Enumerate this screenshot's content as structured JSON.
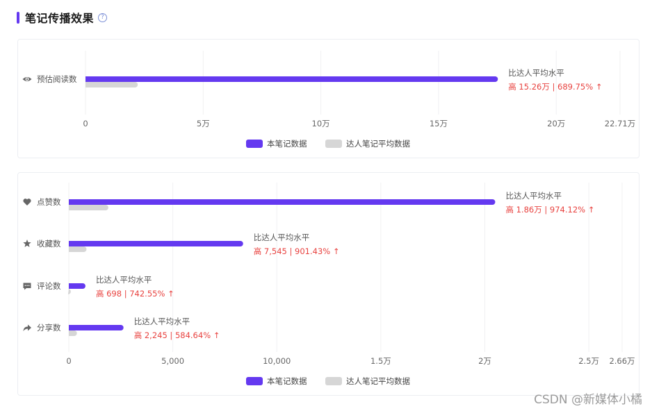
{
  "header": {
    "title": "笔记传播效果",
    "help_icon": "question-circle-icon",
    "accent_color": "#6439f0"
  },
  "legend": {
    "this_note": "本笔记数据",
    "influencer_avg": "达人笔记平均数据"
  },
  "colors": {
    "this_note": "#6439f0",
    "influencer_avg": "#d6d6d6",
    "highlight": "#e8423f"
  },
  "watermark": "CSDN @新媒体小橘",
  "chart_data": [
    {
      "type": "bar",
      "orientation": "horizontal",
      "categories": [
        "预估阅读数"
      ],
      "icons": [
        "eye-icon"
      ],
      "series": [
        {
          "name": "本笔记数据",
          "values": [
            175200
          ]
        },
        {
          "name": "达人笔记平均数据",
          "values": [
            22200
          ]
        }
      ],
      "xlim": [
        0,
        227100
      ],
      "xticks": [
        0,
        50000,
        100000,
        150000,
        200000,
        227100
      ],
      "xtick_labels": [
        "0",
        "5万",
        "10万",
        "15万",
        "20万",
        "22.71万"
      ],
      "annotations": [
        {
          "title": "比达人平均水平",
          "value": "高 15.26万 | 689.75% ↑"
        }
      ],
      "legend_position": "bottom"
    },
    {
      "type": "bar",
      "orientation": "horizontal",
      "categories": [
        "点赞数",
        "收藏数",
        "评论数",
        "分享数"
      ],
      "icons": [
        "heart-icon",
        "star-icon",
        "comment-icon",
        "share-icon"
      ],
      "series": [
        {
          "name": "本笔记数据",
          "values": [
            20500,
            8380,
            800,
            2630
          ]
        },
        {
          "name": "达人笔记平均数据",
          "values": [
            1900,
            850,
            95,
            390
          ]
        }
      ],
      "xlim": [
        0,
        26600
      ],
      "xticks": [
        0,
        5000,
        10000,
        15000,
        20000,
        25000,
        26600
      ],
      "xtick_labels": [
        "0",
        "5,000",
        "10,000",
        "1.5万",
        "2万",
        "2.5万",
        "2.66万"
      ],
      "annotations": [
        {
          "title": "比达人平均水平",
          "value": "高 1.86万 | 974.12% ↑"
        },
        {
          "title": "比达人平均水平",
          "value": "高 7,545 | 901.43% ↑"
        },
        {
          "title": "比达人平均水平",
          "value": "高 698 | 742.55% ↑"
        },
        {
          "title": "比达人平均水平",
          "value": "高 2,245 | 584.64% ↑"
        }
      ],
      "legend_position": "bottom"
    }
  ]
}
